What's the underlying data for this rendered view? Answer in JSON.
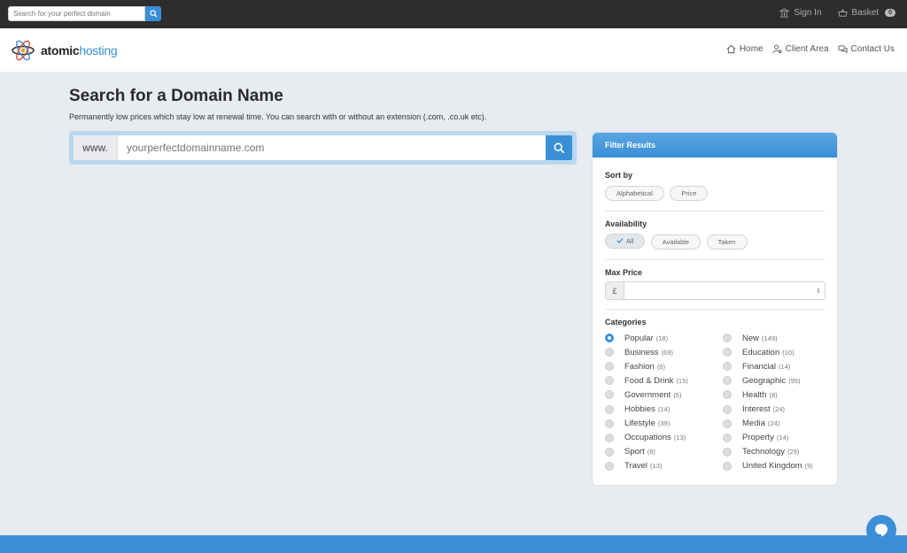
{
  "topbar": {
    "search_placeholder": "Search for your perfect domain",
    "sign_in": "Sign In",
    "basket": "Basket",
    "basket_count": "0"
  },
  "header": {
    "logo_part1": "atomic",
    "logo_part2": "hosting",
    "nav": [
      {
        "label": "Home",
        "icon": "home-icon"
      },
      {
        "label": "Client Area",
        "icon": "user-settings-icon"
      },
      {
        "label": "Contact Us",
        "icon": "chat-bubbles-icon"
      }
    ]
  },
  "main": {
    "title": "Search for a Domain Name",
    "subtitle": "Permanently low prices which stay low at renewal time. You can search with or without an extension (.com, .co.uk etc).",
    "www_prefix": "www.",
    "domain_placeholder": "yourperfectdomainname.com"
  },
  "filter": {
    "title": "Filter Results",
    "sort_by": {
      "label": "Sort by",
      "options": [
        "Alphabetical",
        "Price"
      ]
    },
    "availability": {
      "label": "Availability",
      "options": [
        "All",
        "Available",
        "Taken"
      ],
      "selected": "All"
    },
    "max_price": {
      "label": "Max Price",
      "currency": "£",
      "value": ""
    },
    "categories": {
      "label": "Categories",
      "selected": "Popular",
      "left": [
        {
          "name": "Popular",
          "count": "(18)"
        },
        {
          "name": "Business",
          "count": "(69)"
        },
        {
          "name": "Fashion",
          "count": "(6)"
        },
        {
          "name": "Food & Drink",
          "count": "(15)"
        },
        {
          "name": "Government",
          "count": "(5)"
        },
        {
          "name": "Hobbies",
          "count": "(14)"
        },
        {
          "name": "Lifestyle",
          "count": "(39)"
        },
        {
          "name": "Occupations",
          "count": "(13)"
        },
        {
          "name": "Sport",
          "count": "(8)"
        },
        {
          "name": "Travel",
          "count": "(13)"
        }
      ],
      "right": [
        {
          "name": "New",
          "count": "(149)"
        },
        {
          "name": "Education",
          "count": "(10)"
        },
        {
          "name": "Financial",
          "count": "(14)"
        },
        {
          "name": "Geographic",
          "count": "(95)"
        },
        {
          "name": "Health",
          "count": "(8)"
        },
        {
          "name": "Interest",
          "count": "(24)"
        },
        {
          "name": "Media",
          "count": "(24)"
        },
        {
          "name": "Property",
          "count": "(14)"
        },
        {
          "name": "Technology",
          "count": "(29)"
        },
        {
          "name": "United Kingdom",
          "count": "(9)"
        }
      ]
    }
  },
  "colors": {
    "accent": "#3a8fd6",
    "topbar": "#2d2d2d",
    "background": "#e8ebef"
  }
}
